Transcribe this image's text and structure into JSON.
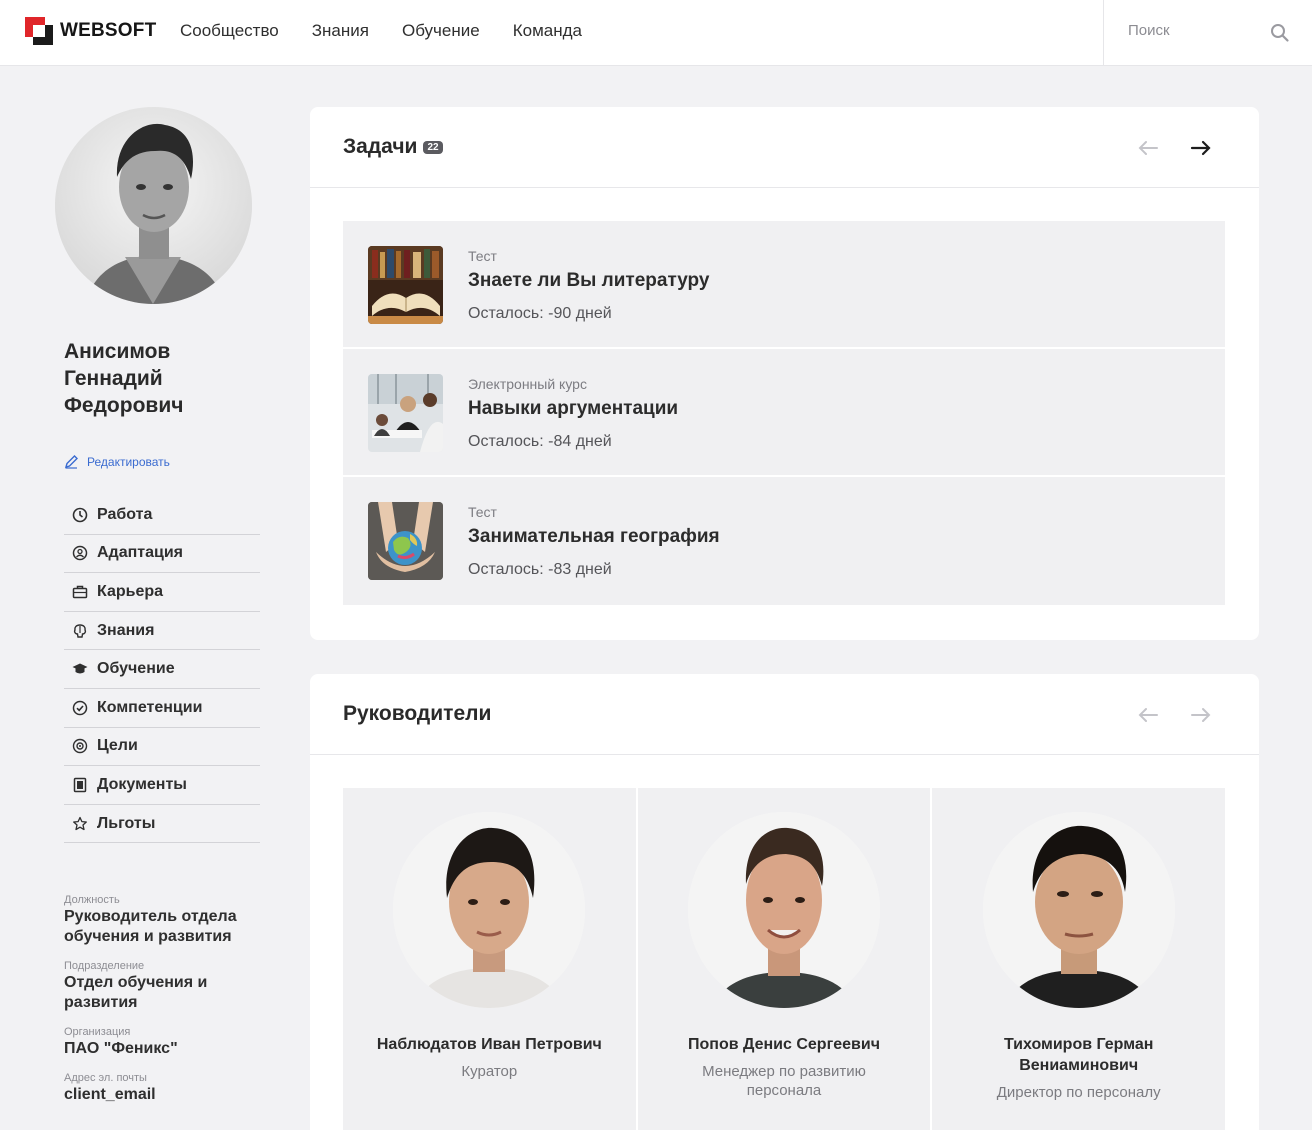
{
  "header": {
    "logo_text": "WEBSOFT",
    "nav": [
      "Сообщество",
      "Знания",
      "Обучение",
      "Команда"
    ],
    "search_placeholder": "Поиск"
  },
  "profile": {
    "name": "Анисимов Геннадий Федорович",
    "edit_label": "Редактировать",
    "menu": [
      {
        "label": "Работа",
        "icon": "clock-icon"
      },
      {
        "label": "Адаптация",
        "icon": "adaptation-icon"
      },
      {
        "label": "Карьера",
        "icon": "briefcase-icon"
      },
      {
        "label": "Знания",
        "icon": "brain-icon"
      },
      {
        "label": "Обучение",
        "icon": "graduation-cap-icon"
      },
      {
        "label": "Компетенции",
        "icon": "check-circle-icon"
      },
      {
        "label": "Цели",
        "icon": "target-icon"
      },
      {
        "label": "Документы",
        "icon": "document-icon"
      },
      {
        "label": "Льготы",
        "icon": "star-icon"
      }
    ],
    "info": [
      {
        "label": "Должность",
        "value": "Руководитель отдела обучения и развития"
      },
      {
        "label": "Подразделение",
        "value": "Отдел обучения и развития"
      },
      {
        "label": "Организация",
        "value": "ПАО \"Феникс\""
      },
      {
        "label": "Адрес эл. почты",
        "value": "client_email"
      }
    ]
  },
  "tasks": {
    "title": "Задачи",
    "count": "22",
    "items": [
      {
        "type": "Тест",
        "name": "Знаете ли Вы литературу",
        "remaining": "Осталось: -90 дней"
      },
      {
        "type": "Электронный курс",
        "name": "Навыки аргументации",
        "remaining": "Осталось: -84 дней"
      },
      {
        "type": "Тест",
        "name": "Занимательная география",
        "remaining": "Осталось: -83 дней"
      }
    ]
  },
  "leaders": {
    "title": "Руководители",
    "items": [
      {
        "name": "Наблюдатов Иван Петрович",
        "role": "Куратор"
      },
      {
        "name": "Попов Денис Сергеевич",
        "role": "Менеджер по развитию персонала"
      },
      {
        "name": "Тихомиров Герман Вениаминович",
        "role": "Директор по персоналу"
      }
    ]
  },
  "colors": {
    "brand_red": "#e0262a",
    "link_blue": "#3a6bd0",
    "page_bg": "#f2f2f4"
  }
}
